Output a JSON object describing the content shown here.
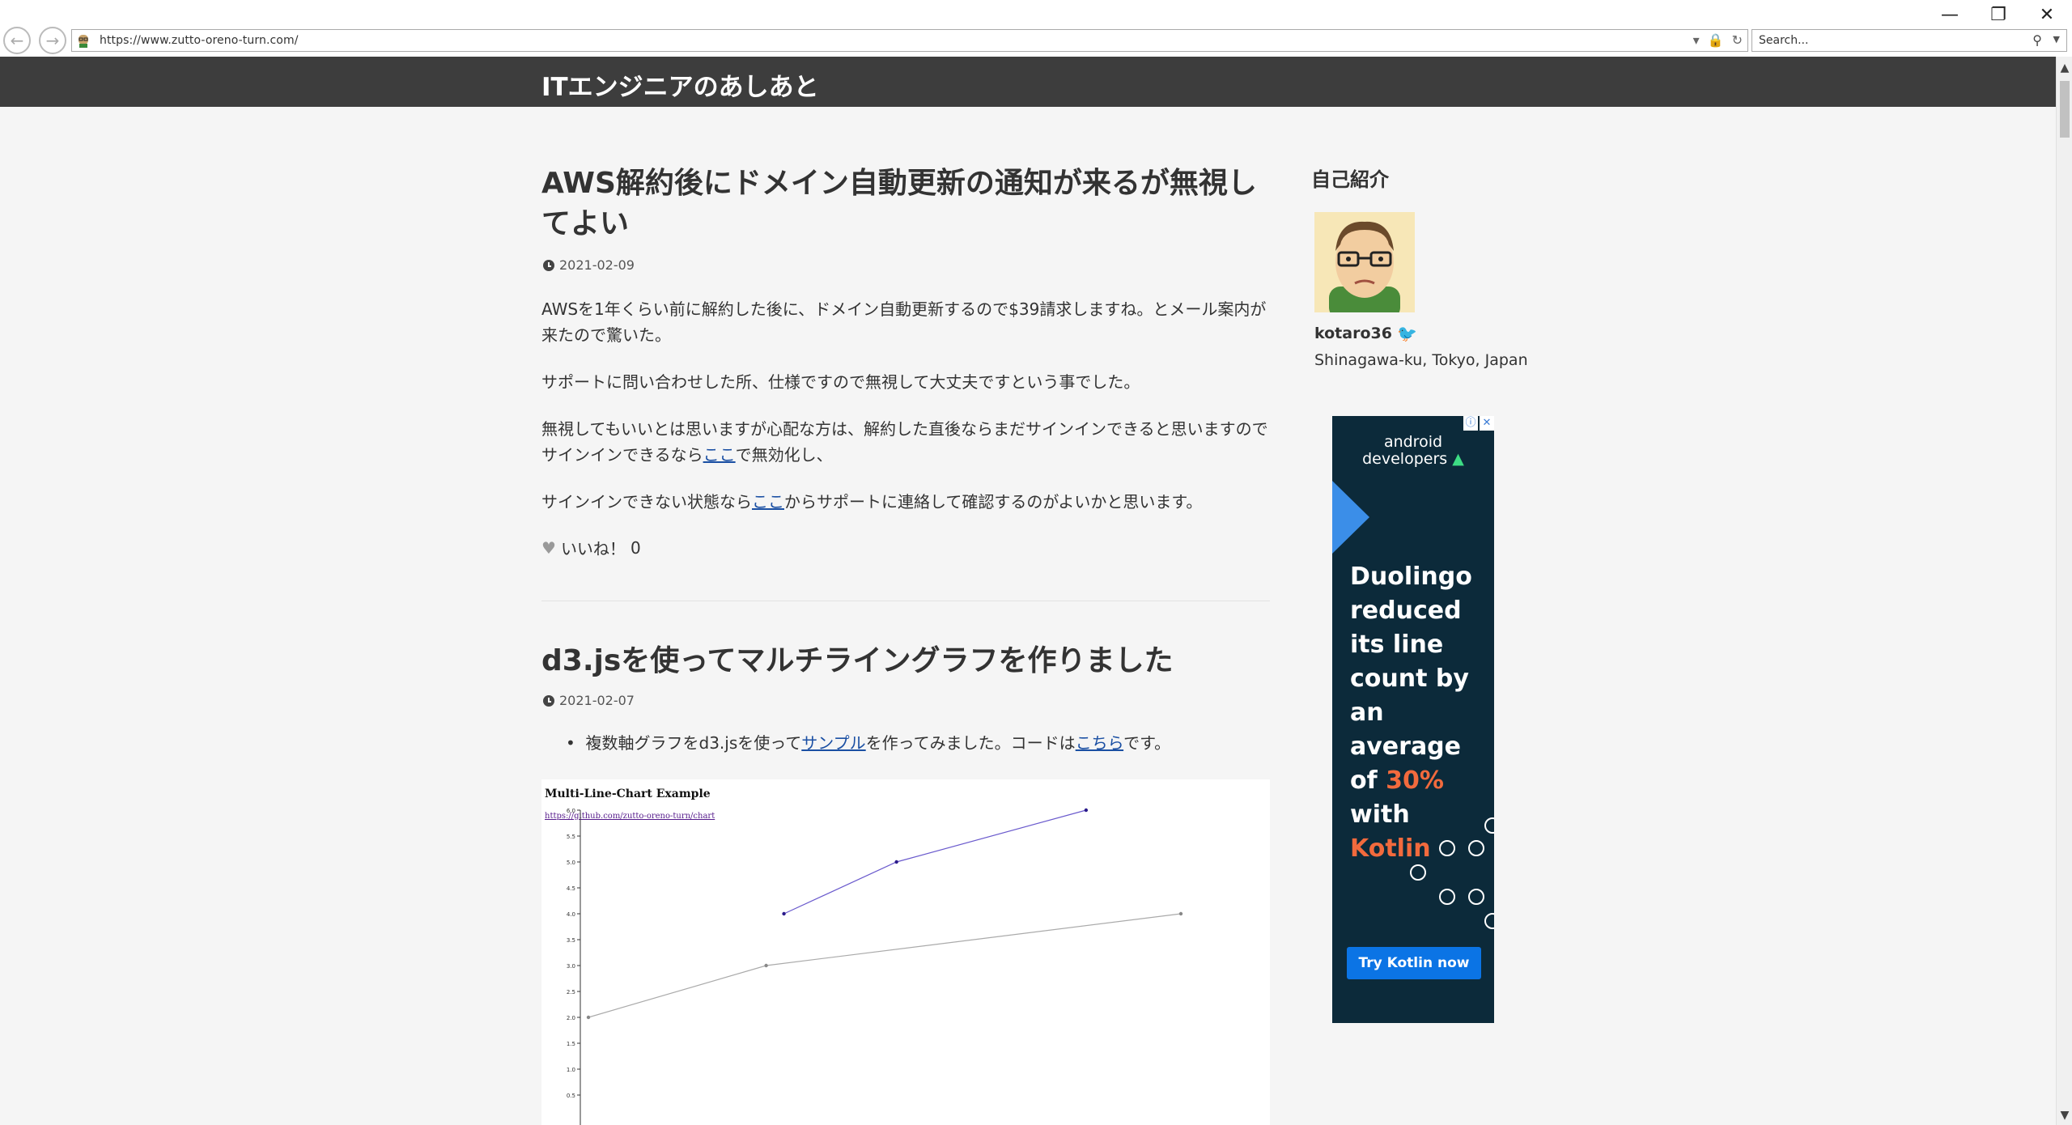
{
  "browser": {
    "url": "https://www.zutto-oreno-turn.com/",
    "search_placeholder": "Search...",
    "window_controls": {
      "minimize": "—",
      "maximize": "❐",
      "close": "✕"
    }
  },
  "site": {
    "title": "ITエンジニアのあしあと"
  },
  "post1": {
    "title": "AWS解約後にドメイン自動更新の通知が来るが無視してよい",
    "date": "2021-02-09",
    "para1": "AWSを1年くらい前に解約した後に、ドメイン自動更新するので$39請求しますね。とメール案内が来たので驚いた。",
    "para2": "サポートに問い合わせした所、仕様ですので無視して大丈夫ですという事でした。",
    "para3_pre": "無視してもいいとは思いますが心配な方は、解約した直後ならまだサインインできると思いますのでサインインできるなら",
    "para3_link": "ここ",
    "para3_post": "で無効化し、",
    "para4_pre": "サインインできない状態なら",
    "para4_link": "ここ",
    "para4_post": "からサポートに連絡して確認するのがよいかと思います。",
    "like_label": "いいね！",
    "like_count": "0"
  },
  "post2": {
    "title": "d3.jsを使ってマルチライングラフを作りました",
    "date": "2021-02-07",
    "bullet_pre": "複数軸グラフをd3.jsを使って",
    "bullet_link1": "サンプル",
    "bullet_mid": "を作ってみました。コードは",
    "bullet_link2": "こちら",
    "bullet_post": "です。"
  },
  "chart_data": {
    "type": "line",
    "title": "Multi-Line-Chart Example",
    "link": "https://github.com/zutto-oreno-turn/chart",
    "ylim": [
      0,
      6.0
    ],
    "yticks": [
      "0.5",
      "1.0",
      "1.5",
      "2.0",
      "2.5",
      "3.0",
      "3.5",
      "4.0",
      "4.5",
      "5.0",
      "5.5",
      "6.0"
    ],
    "series": [
      {
        "color": "#6a5acd",
        "points": [
          [
            0.33,
            4.0
          ],
          [
            0.52,
            5.0
          ],
          [
            0.84,
            6.0
          ]
        ]
      },
      {
        "color": "#aaaaaa",
        "points": [
          [
            0.0,
            2.0
          ],
          [
            0.3,
            3.0
          ],
          [
            1.0,
            4.0
          ]
        ]
      }
    ]
  },
  "sidebar": {
    "heading": "自己紹介",
    "name": "kotaro36",
    "location": "Shinagawa-ku, Tokyo, Japan"
  },
  "ad": {
    "brand_line1": "android",
    "brand_line2": "developers",
    "copy_1": "Duolingo reduced its line count by an average of ",
    "copy_highlight1": "30%",
    "copy_2": " with ",
    "copy_highlight2": "Kotlin",
    "cta": "Try Kotlin now",
    "colors": {
      "bg": "#0c2a3a",
      "accent": "#f26a3d",
      "button": "#0b74e5"
    }
  }
}
